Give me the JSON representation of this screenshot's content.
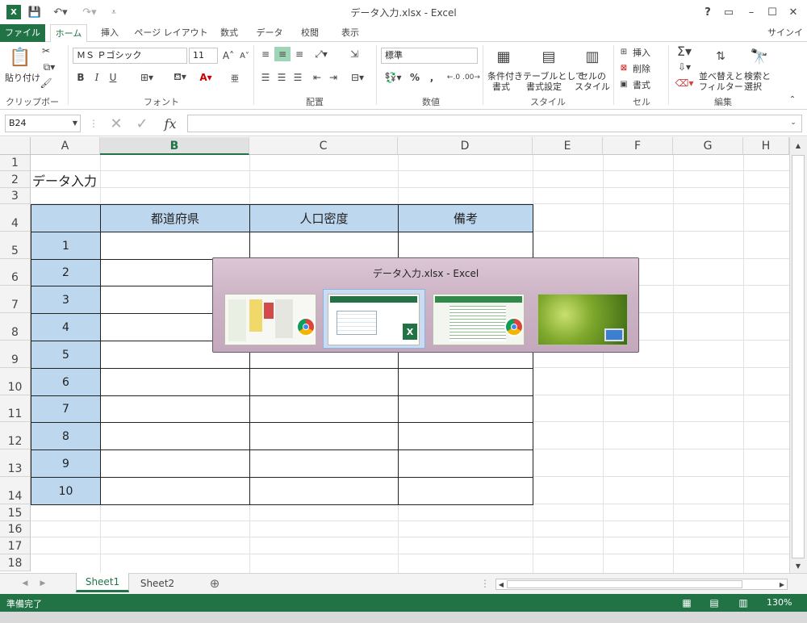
{
  "window": {
    "title": "データ入力.xlsx - Excel",
    "help": "?",
    "controls": [
      "▭",
      "–",
      "☐",
      "✕"
    ]
  },
  "tabs": {
    "file": "ファイル",
    "items": [
      "ホーム",
      "挿入",
      "ページ レイアウト",
      "数式",
      "データ",
      "校閲",
      "表示"
    ],
    "signin": "サインイン"
  },
  "ribbon": {
    "clipboard": {
      "paste": "貼り付け",
      "label": "クリップボード"
    },
    "font": {
      "name": "ＭＳ Ｐゴシック",
      "size": "11",
      "label": "フォント",
      "bold": "B",
      "italic": "I",
      "underline": "U"
    },
    "alignment": {
      "label": "配置"
    },
    "number": {
      "format": "標準",
      "label": "数値",
      "percent": "%",
      "comma": ","
    },
    "styles": {
      "conditional": [
        "条件付き",
        "書式"
      ],
      "table": [
        "テーブルとして",
        "書式設定"
      ],
      "cell": [
        "セルの",
        "スタイル"
      ],
      "label": "スタイル"
    },
    "cells": {
      "insert": "挿入",
      "delete": "削除",
      "format": "書式",
      "label": "セル"
    },
    "editing": {
      "sort": [
        "並べ替えと",
        "フィルター"
      ],
      "find": [
        "検索と",
        "選択"
      ],
      "label": "編集"
    }
  },
  "formula_bar": {
    "name_box": "B24",
    "fx": "fx",
    "value": ""
  },
  "columns": [
    "A",
    "B",
    "C",
    "D",
    "E",
    "F",
    "G",
    "H"
  ],
  "selected_column": "B",
  "rows": [
    "1",
    "2",
    "3",
    "4",
    "5",
    "6",
    "7",
    "8",
    "9",
    "10",
    "11",
    "12",
    "13",
    "14",
    "15",
    "16",
    "17",
    "18"
  ],
  "sheet": {
    "title": "データ入力",
    "table_headers": [
      "都道府県",
      "人口密度",
      "備考"
    ],
    "row_numbers": [
      "1",
      "2",
      "3",
      "4",
      "5",
      "6",
      "7",
      "8",
      "9",
      "10"
    ]
  },
  "sheet_tabs": {
    "items": [
      "Sheet1",
      "Sheet2"
    ],
    "active": "Sheet1",
    "add": "⊕"
  },
  "status": {
    "text": "準備完了",
    "zoom": "130%"
  },
  "switcher": {
    "title": "データ入力.xlsx - Excel",
    "thumbnails": [
      {
        "name": "Chrome window",
        "badge": "chrome-icon"
      },
      {
        "name": "Excel window",
        "badge": "excel-icon"
      },
      {
        "name": "Chrome window",
        "badge": "chrome-icon"
      },
      {
        "name": "Desktop",
        "badge": "desktop-icon"
      }
    ]
  }
}
